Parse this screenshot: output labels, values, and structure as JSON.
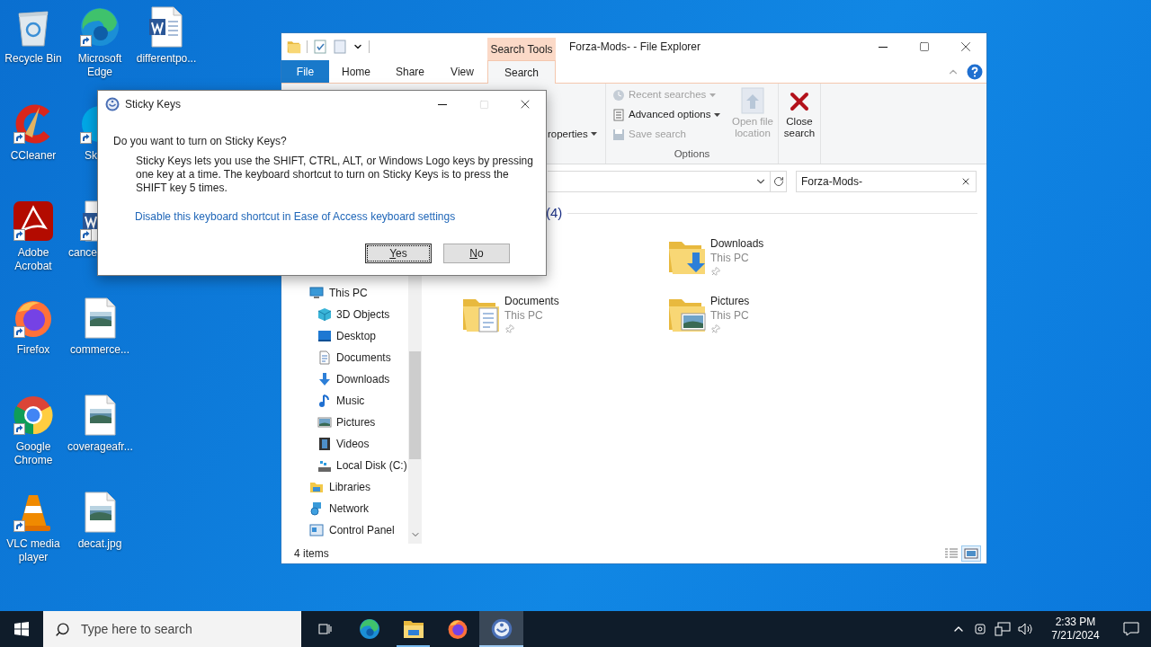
{
  "desktop": {
    "columns": [
      [
        {
          "label": "Recycle Bin",
          "shortcut": false
        },
        {
          "label": "CCleaner",
          "shortcut": true
        },
        {
          "label": "Adobe Acrobat",
          "shortcut": true
        },
        {
          "label": "Firefox",
          "shortcut": true
        },
        {
          "label": "Google Chrome",
          "shortcut": true
        },
        {
          "label": "VLC media player",
          "shortcut": true
        }
      ],
      [
        {
          "label": "Microsoft Edge",
          "shortcut": true
        },
        {
          "label": "Sk",
          "shortcut": true
        },
        {
          "label": "cance",
          "shortcut": true
        },
        {
          "label": "commerce...",
          "shortcut": false
        },
        {
          "label": "coverageafr...",
          "shortcut": false
        },
        {
          "label": "decat.jpg",
          "shortcut": false
        }
      ],
      [
        {
          "label": "differentpo...",
          "shortcut": false
        }
      ]
    ]
  },
  "explorer": {
    "title": "Forza-Mods- - File Explorer",
    "context_tab_group": "Search Tools",
    "tabs": [
      {
        "label": "File",
        "selected": false,
        "kind": "file"
      },
      {
        "label": "Home",
        "selected": false,
        "kind": "tab"
      },
      {
        "label": "Share",
        "selected": false,
        "kind": "tab"
      },
      {
        "label": "View",
        "selected": false,
        "kind": "tab"
      },
      {
        "label": "Search",
        "selected": true,
        "kind": "tab"
      }
    ],
    "ribbon": {
      "partial_command": "roperties",
      "options_group": {
        "label": "Options",
        "commands": [
          {
            "label": "Recent searches",
            "disabled": true,
            "dropdown": true
          },
          {
            "label": "Advanced options",
            "disabled": false,
            "dropdown": true
          },
          {
            "label": "Save search",
            "disabled": true,
            "dropdown": false
          }
        ],
        "large_command": {
          "label": "Open file location",
          "disabled": true
        }
      },
      "close_search": {
        "label": "Close search"
      }
    },
    "search_box": {
      "value": "Forza-Mods-"
    },
    "nav_pane": [
      {
        "label": "This PC",
        "children": [
          {
            "label": "3D Objects"
          },
          {
            "label": "Desktop"
          },
          {
            "label": "Documents"
          },
          {
            "label": "Downloads"
          },
          {
            "label": "Music"
          },
          {
            "label": "Pictures"
          },
          {
            "label": "Videos"
          },
          {
            "label": "Local Disk (C:)"
          }
        ]
      },
      {
        "label": "Libraries"
      },
      {
        "label": "Network"
      },
      {
        "label": "Control Panel"
      }
    ],
    "group_header": "(4)",
    "items": [
      {
        "name": "Downloads",
        "location": "This PC",
        "pinned": true
      },
      {
        "name": "Documents",
        "location": "This PC",
        "pinned": true
      },
      {
        "name": "Pictures",
        "location": "This PC",
        "pinned": true
      }
    ],
    "status": "4 items",
    "view_buttons": [
      {
        "selected": false
      },
      {
        "selected": true
      }
    ]
  },
  "dialog": {
    "title": "Sticky Keys",
    "question": "Do you want to turn on Sticky Keys?",
    "body": "Sticky Keys lets you use the SHIFT, CTRL, ALT, or Windows Logo keys by pressing one key at a time. The keyboard shortcut to turn on Sticky Keys is to press the SHIFT key 5 times.",
    "link": "Disable this keyboard shortcut in Ease of Access keyboard settings",
    "buttons": [
      {
        "label": "Yes",
        "focused": true
      },
      {
        "label": "No",
        "focused": false
      }
    ]
  },
  "taskbar": {
    "search_placeholder": "Type here to search",
    "apps": [
      {
        "running": false,
        "active": false
      },
      {
        "running": false,
        "active": false
      },
      {
        "running": true,
        "active": false
      },
      {
        "running": false,
        "active": false
      },
      {
        "running": true,
        "active": true
      }
    ],
    "time": "2:33 PM",
    "date": "7/21/2024"
  }
}
